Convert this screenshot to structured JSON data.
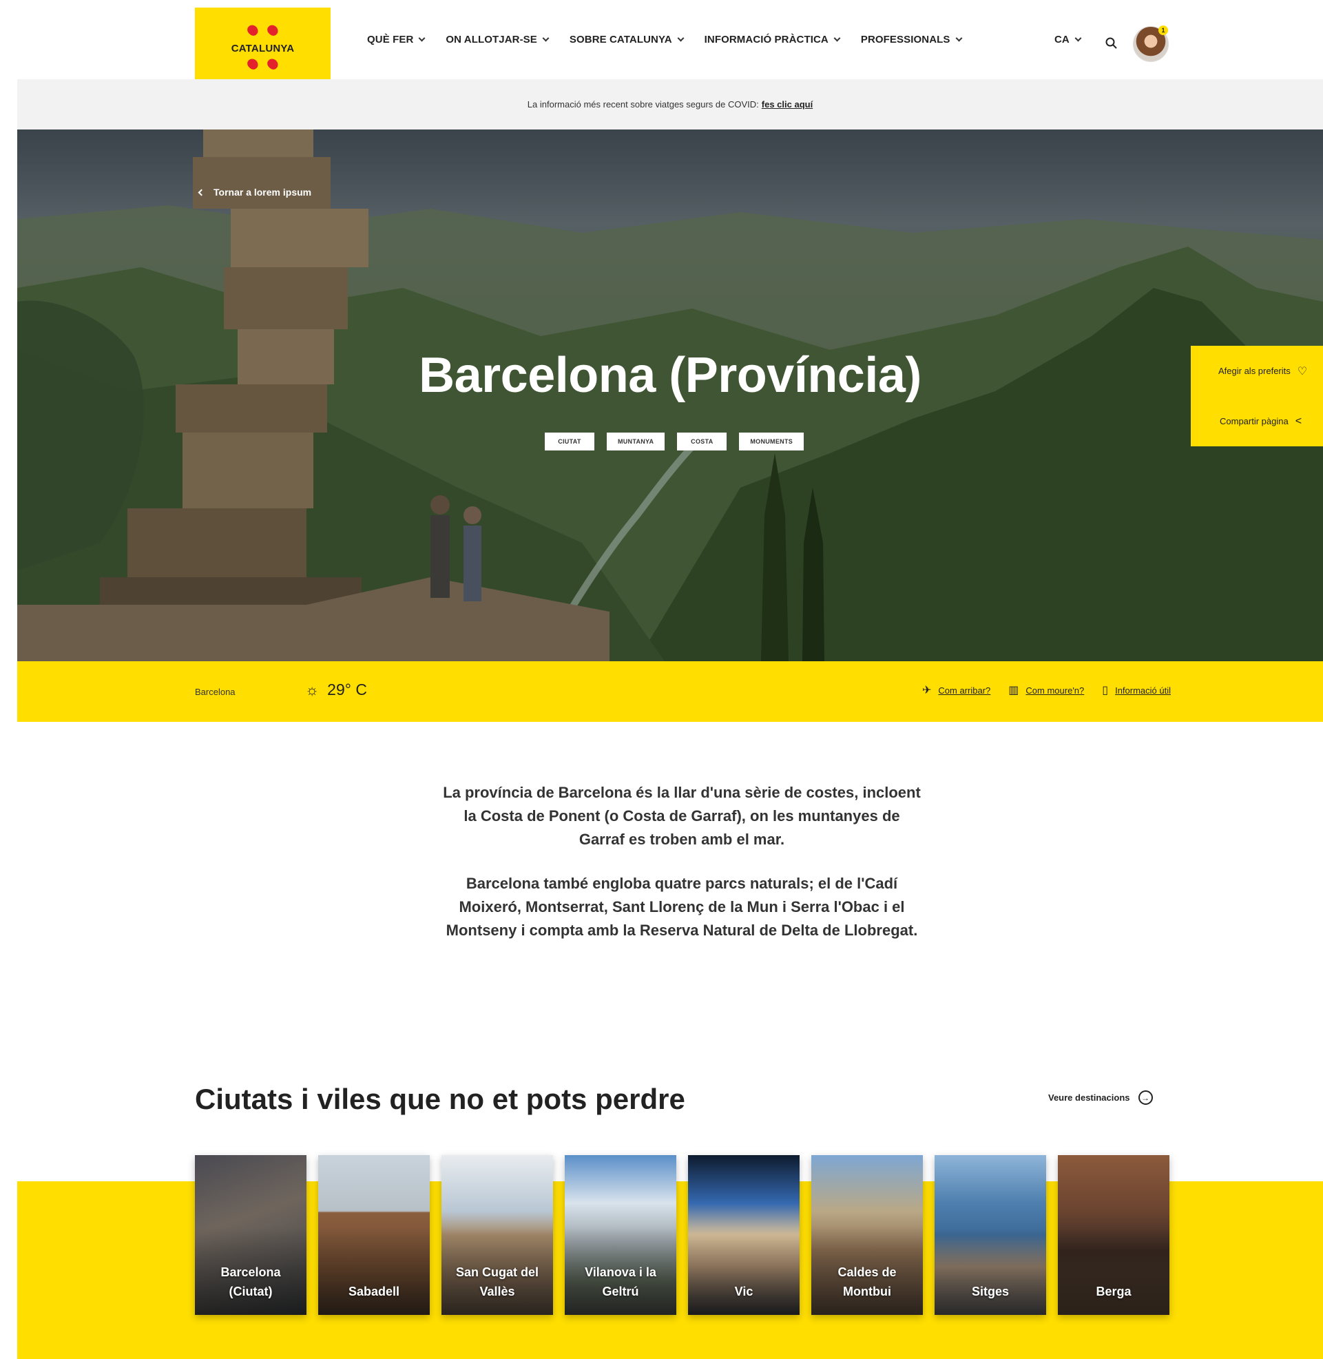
{
  "header": {
    "logo_text": "CATALUNYA",
    "nav": [
      {
        "label": "QUÈ FER"
      },
      {
        "label": "ON ALLOTJAR-SE"
      },
      {
        "label": "SOBRE CATALUNYA"
      },
      {
        "label": "INFORMACIÓ PRÀCTICA"
      },
      {
        "label": "PROFESSIONALS"
      }
    ],
    "language": "CA",
    "avatar_badge": "1"
  },
  "covid_bar": {
    "text": "La informació més recent sobre viatges segurs de COVID:",
    "link": "fes clic aquí"
  },
  "hero": {
    "back_link": "Tornar a lorem ipsum",
    "title": "Barcelona (Província)",
    "tags": [
      "CIUTAT",
      "MUNTANYA",
      "COSTA",
      "MONUMENTS"
    ],
    "side_actions": [
      {
        "label": "Afegir als preferits",
        "icon": "heart-icon"
      },
      {
        "label": "Compartir pàgina",
        "icon": "share-icon"
      }
    ]
  },
  "info_bar": {
    "city": "Barcelona",
    "temperature": "29° C",
    "weather_icon": "sun-icon",
    "links": [
      {
        "label": "Com arribar?",
        "icon": "plane-icon"
      },
      {
        "label": "Com moure'n?",
        "icon": "map-icon"
      },
      {
        "label": "Informació útil",
        "icon": "tablet-icon"
      }
    ]
  },
  "intro": {
    "p1": "La província de Barcelona és la llar d'una sèrie de costes, incloent la Costa de Ponent (o Costa de Garraf), on les muntanyes de Garraf es troben amb el mar.",
    "p2": "Barcelona també engloba quatre parcs naturals; el de l'Cadí Moixeró, Montserrat, Sant Llorenç de la Mun i Serra l'Obac i el Montseny i compta amb la Reserva Natural de Delta de Llobregat."
  },
  "cities_section": {
    "title": "Ciutats i viles que no et pots perdre",
    "see_all": "Veure destinacions",
    "cards": [
      {
        "name": "Barcelona (Ciutat)"
      },
      {
        "name": "Sabadell"
      },
      {
        "name": "San Cugat del Vallès"
      },
      {
        "name": "Vilanova i la Geltrú"
      },
      {
        "name": "Vic"
      },
      {
        "name": "Caldes de Montbui"
      },
      {
        "name": "Sitges"
      },
      {
        "name": "Berga"
      }
    ]
  },
  "colors": {
    "brand_yellow": "#ffde00",
    "brand_red": "#e4222b",
    "text_dark": "#222222"
  }
}
